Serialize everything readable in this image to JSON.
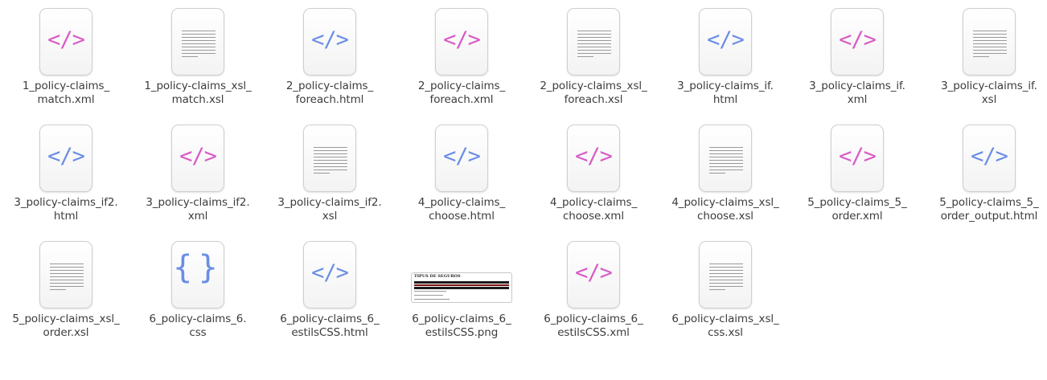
{
  "colors": {
    "code_pink": "#d85bc6",
    "code_blue": "#6a8ee6",
    "css_blue": "#6a8ee6",
    "label_text": "#3c3c3c"
  },
  "files": [
    {
      "name": "1_policy-claims_match.xml",
      "label": "1_policy-claims_\nmatch.xml",
      "icon": "code-icon",
      "color": "#d85bc6"
    },
    {
      "name": "1_policy-claims_xsl_match.xsl",
      "label": "1_policy-claims_xsl_\nmatch.xsl",
      "icon": "text-document-icon"
    },
    {
      "name": "2_policy-claims_foreach.html",
      "label": "2_policy-claims_\nforeach.html",
      "icon": "code-icon",
      "color": "#6a8ee6"
    },
    {
      "name": "2_policy-claims_foreach.xml",
      "label": "2_policy-claims_\nforeach.xml",
      "icon": "code-icon",
      "color": "#d85bc6"
    },
    {
      "name": "2_policy-claims_xsl_foreach.xsl",
      "label": "2_policy-claims_xsl_\nforeach.xsl",
      "icon": "text-document-icon"
    },
    {
      "name": "3_policy-claims_if.html",
      "label": "3_policy-claims_if.\nhtml",
      "icon": "code-icon",
      "color": "#6a8ee6"
    },
    {
      "name": "3_policy-claims_if.xml",
      "label": "3_policy-claims_if.\nxml",
      "icon": "code-icon",
      "color": "#d85bc6"
    },
    {
      "name": "3_policy-claims_if.xsl",
      "label": "3_policy-claims_if.\nxsl",
      "icon": "text-document-icon"
    },
    {
      "name": "3_policy-claims_if2.html",
      "label": "3_policy-claims_if2.\nhtml",
      "icon": "code-icon",
      "color": "#6a8ee6"
    },
    {
      "name": "3_policy-claims_if2.xml",
      "label": "3_policy-claims_if2.\nxml",
      "icon": "code-icon",
      "color": "#d85bc6"
    },
    {
      "name": "3_policy-claims_if2.xsl",
      "label": "3_policy-claims_if2.\nxsl",
      "icon": "text-document-icon"
    },
    {
      "name": "4_policy-claims_choose.html",
      "label": "4_policy-claims_\nchoose.html",
      "icon": "code-icon",
      "color": "#6a8ee6"
    },
    {
      "name": "4_policy-claims_choose.xml",
      "label": "4_policy-claims_\nchoose.xml",
      "icon": "code-icon",
      "color": "#d85bc6"
    },
    {
      "name": "4_policy-claims_xsl_choose.xsl",
      "label": "4_policy-claims_xsl_\nchoose.xsl",
      "icon": "text-document-icon"
    },
    {
      "name": "5_policy-claims_5_order.xml",
      "label": "5_policy-claims_5_\norder.xml",
      "icon": "code-icon",
      "color": "#d85bc6"
    },
    {
      "name": "5_policy-claims_5_order_output.html",
      "label": "5_policy-claims_5_\norder_output.html",
      "icon": "code-icon",
      "color": "#6a8ee6"
    },
    {
      "name": "5_policy-claims_xsl_order.xsl",
      "label": "5_policy-claims_xsl_\norder.xsl",
      "icon": "text-document-icon"
    },
    {
      "name": "6_policy-claims_6.css",
      "label": "6_policy-claims_6.\ncss",
      "icon": "css-braces-icon",
      "color": "#6a8ee6"
    },
    {
      "name": "6_policy-claims_6_estilsCSS.html",
      "label": "6_policy-claims_6_\nestilsCSS.html",
      "icon": "code-icon",
      "color": "#6a8ee6"
    },
    {
      "name": "6_policy-claims_6_estilsCSS.png",
      "label": "6_policy-claims_6_\nestilsCSS.png",
      "icon": "image-thumbnail",
      "thumb_title": "TIPUS DE SEGUROS"
    },
    {
      "name": "6_policy-claims_6_estilsCSS.xml",
      "label": "6_policy-claims_6_\nestilsCSS.xml",
      "icon": "code-icon",
      "color": "#d85bc6"
    },
    {
      "name": "6_policy-claims_xsl_css.xsl",
      "label": "6_policy-claims_xsl_\ncss.xsl",
      "icon": "text-document-icon"
    }
  ]
}
